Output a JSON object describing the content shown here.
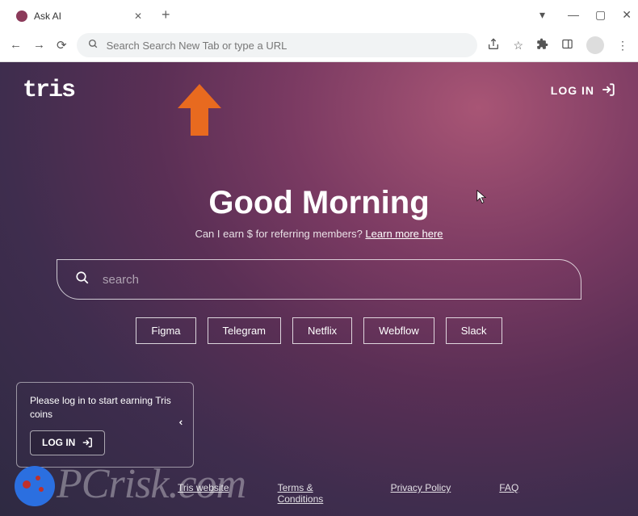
{
  "browser": {
    "tab_title": "Ask AI",
    "omnibox_placeholder": "Search Search New Tab or type a URL"
  },
  "header": {
    "logo_text": "tris",
    "login_label": "LOG IN"
  },
  "hero": {
    "greeting": "Good Morning",
    "subtext_prefix": "Can I earn $ for referring members? ",
    "subtext_link": "Learn more here",
    "search_placeholder": "search"
  },
  "quick_links": [
    "Figma",
    "Telegram",
    "Netflix",
    "Webflow",
    "Slack"
  ],
  "toast": {
    "message": "Please log in to start earning Tris coins",
    "login_label": "LOG IN"
  },
  "footer": {
    "links": [
      "Tris website",
      "Terms & Conditions",
      "Privacy Policy",
      "FAQ"
    ]
  },
  "watermark": "PCrisk.com",
  "colors": {
    "accent_arrow": "#e86a1f",
    "bg_gradient_top": "#a85575",
    "bg_gradient_bottom": "#2e2a42"
  }
}
